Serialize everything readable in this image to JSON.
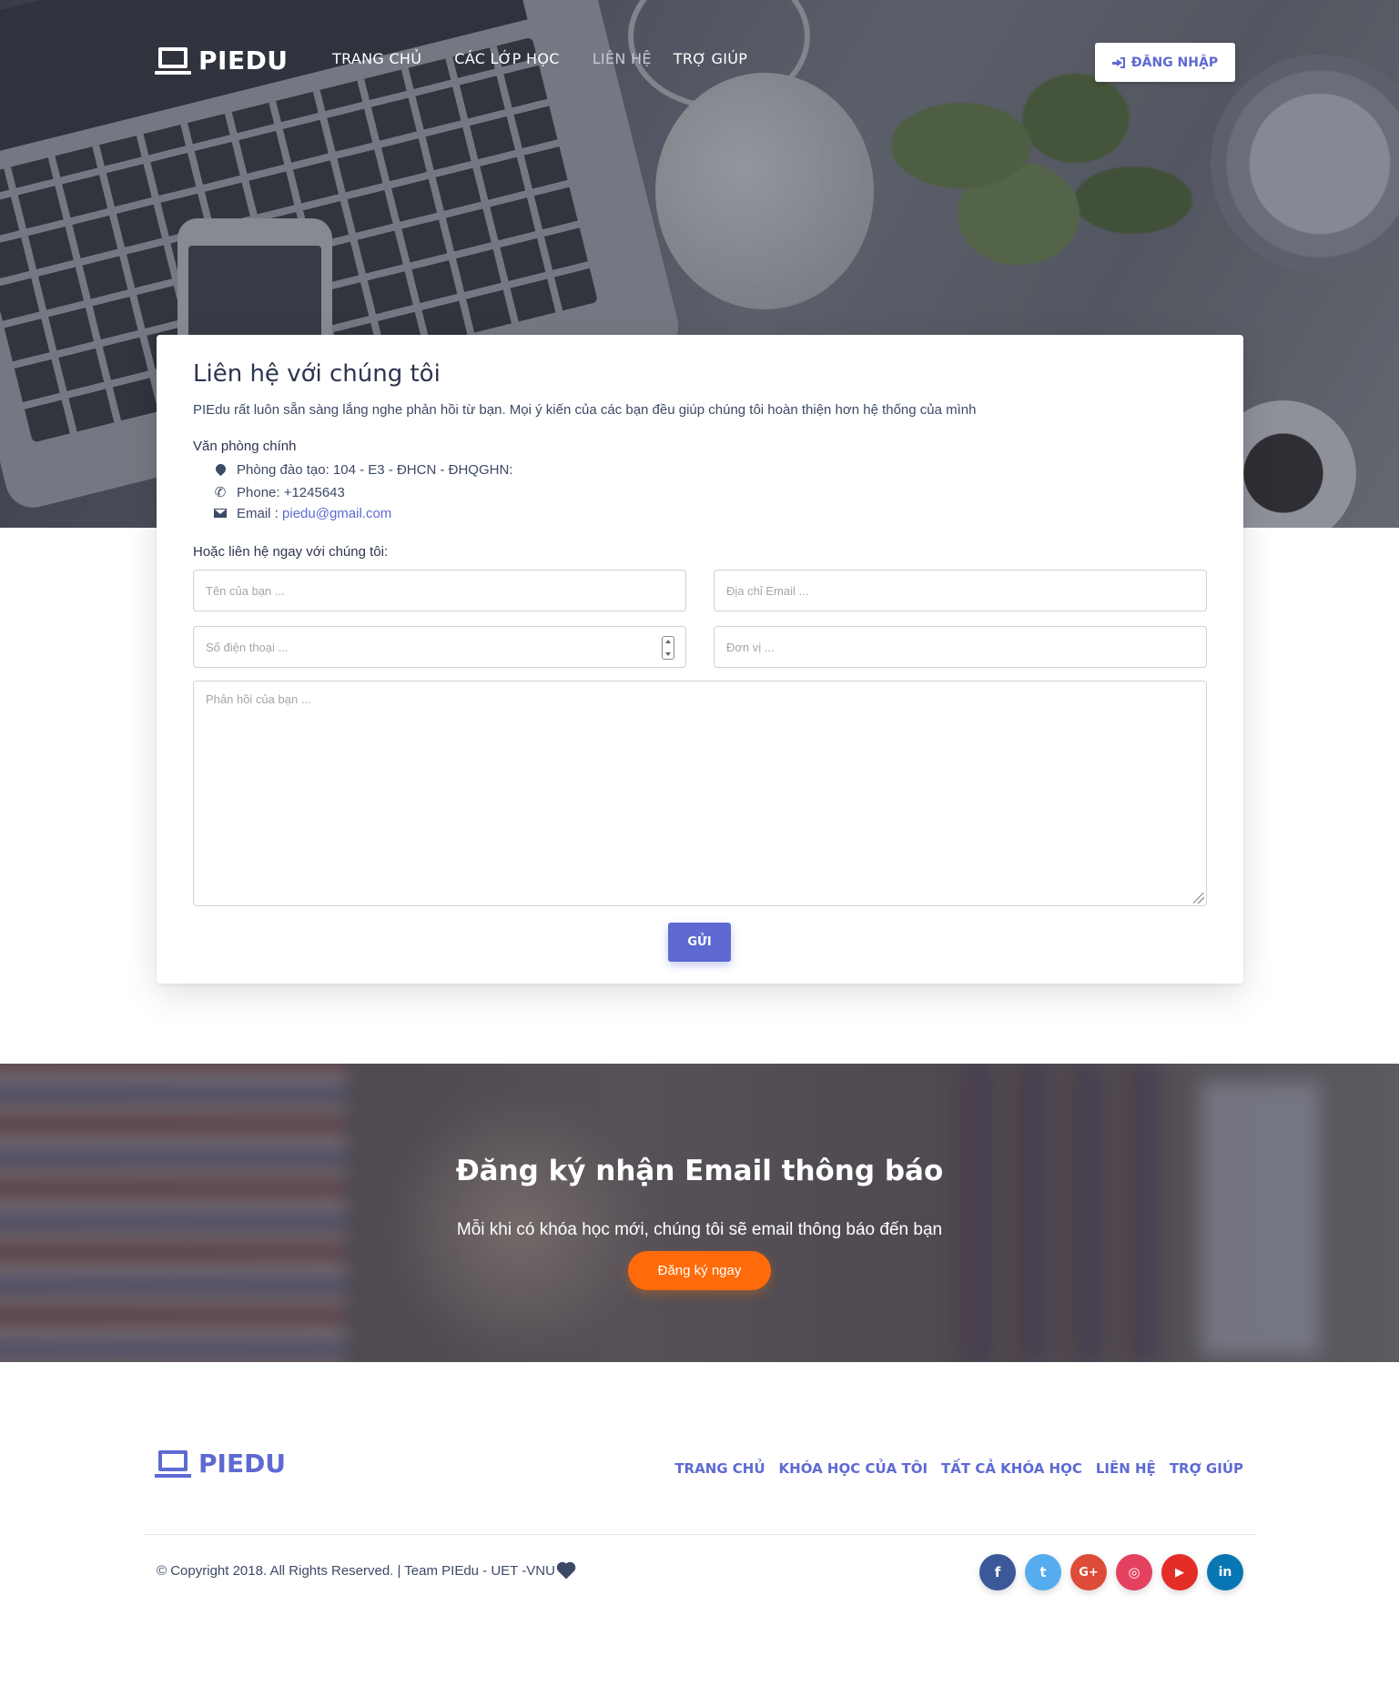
{
  "nav": {
    "brand": "PIEDU",
    "links": [
      "TRANG CHỦ",
      "CÁC LỚP HỌC",
      "LIÊN HỆ",
      "TRỢ GIÚP"
    ],
    "login_label": "ĐĂNG NHẬP"
  },
  "contact": {
    "title": "Liên hệ với chúng tôi",
    "description": "PIEdu rất luôn sẵn sàng lắng nghe phản hồi từ bạn. Mọi ý kiến của các bạn đều giúp chúng tôi hoàn thiện hơn hệ thống của mình",
    "office_title": "Văn phòng chính",
    "address": "Phòng đào tạo: 104 - E3 - ĐHCN - ĐHQGHN:",
    "phone": "Phone: +1245643",
    "email_label": "Email : ",
    "email": "piedu@gmail.com",
    "contact_now": "Hoặc liên hệ ngay với chúng tôi:",
    "placeholders": {
      "name": "Tên của bạn ...",
      "email": "Địa chỉ Email ...",
      "phone": "Số điện thoại ...",
      "unit": "Đơn vị ...",
      "feedback": "Phản hồi của bạn ..."
    },
    "send_label": "GỬI"
  },
  "subscribe": {
    "title": "Đăng ký nhận Email thông báo",
    "description": "Mỗi khi có khóa học mới, chúng tôi sẽ email thông báo đến bạn",
    "button": "Đăng ký ngay"
  },
  "footer": {
    "brand": "PIEDU",
    "links": [
      "TRANG CHỦ",
      "KHÓA HỌC CỦA TÔI",
      "TẤT CẢ KHÓA HỌC",
      "LIÊN HỆ",
      "TRỢ GIÚP"
    ],
    "copyright": "© Copyright 2018. All Rights Reserved. | Team PIEdu - UET -VNU",
    "socials": [
      {
        "name": "facebook-icon",
        "glyph": "f",
        "color": "#3b5998"
      },
      {
        "name": "twitter-icon",
        "glyph": "t",
        "color": "#55acee"
      },
      {
        "name": "google-plus-icon",
        "glyph": "G+",
        "color": "#dd4b39"
      },
      {
        "name": "instagram-icon",
        "glyph": "◎",
        "color": "#e4405f"
      },
      {
        "name": "youtube-icon",
        "glyph": "▶",
        "color": "#e52d27"
      },
      {
        "name": "linkedin-icon",
        "glyph": "in",
        "color": "#0976b4"
      }
    ]
  },
  "colors": {
    "primary": "#5e6ad2",
    "accent": "#ff6b0a"
  }
}
